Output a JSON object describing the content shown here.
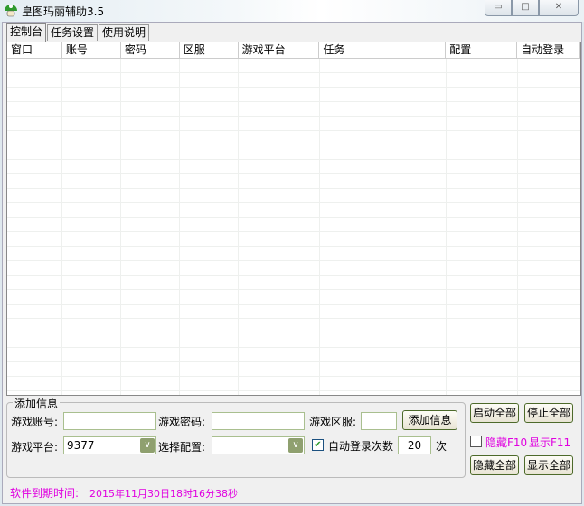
{
  "window": {
    "title": "皇图玛丽辅助3.5",
    "minimize": "▭",
    "maximize": "□",
    "close": "✕"
  },
  "tabs": [
    "控制台",
    "任务设置",
    "使用说明"
  ],
  "table": {
    "columns": [
      "窗口",
      "账号",
      "密码",
      "区服",
      "游戏平台",
      "任务",
      "配置",
      "自动登录"
    ]
  },
  "add_info": {
    "group_title": "添加信息",
    "account_label": "游戏账号:",
    "account_value": "",
    "password_label": "游戏密码:",
    "password_value": "",
    "server_label": "游戏区服:",
    "server_value": "",
    "add_button": "添加信息",
    "platform_label": "游戏平台:",
    "platform_value": "9377",
    "config_label": "选择配置:",
    "config_value": "",
    "auto_login_checked": true,
    "auto_login_label": "自动登录次数",
    "auto_login_count": "20",
    "times_unit": "次"
  },
  "side": {
    "start_all": "启动全部",
    "stop_all": "停止全部",
    "hotkey_checked": false,
    "hide_hotkey": "隐藏F10",
    "show_hotkey": "显示F11",
    "hide_all": "隐藏全部",
    "show_all": "显示全部"
  },
  "status": {
    "expire_label": "软件到期时间:",
    "expire_value": "2015年11月30日18时16分38秒"
  },
  "colors": {
    "accent": "#e000e0"
  }
}
